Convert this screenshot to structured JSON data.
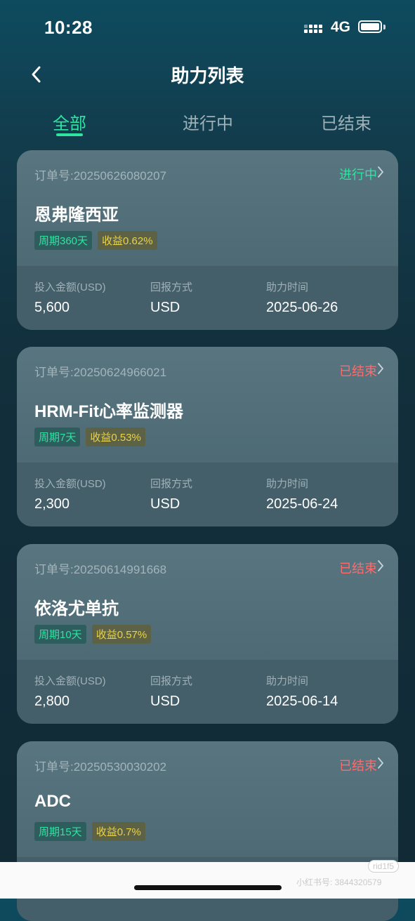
{
  "status_bar": {
    "time": "10:28",
    "network": "4G"
  },
  "header": {
    "title": "助力列表"
  },
  "tabs": [
    {
      "label": "全部",
      "active": true
    },
    {
      "label": "进行中",
      "active": false
    },
    {
      "label": "已结束",
      "active": false
    }
  ],
  "cards": [
    {
      "order_no": "订单号:20250626080207",
      "status": "进行中",
      "status_color": "#2fe3a0",
      "name": "恩弗隆西亚",
      "period": "周期360天",
      "yield": "收益0.62%",
      "amount_label": "投入金额(USD)",
      "amount": "5,600",
      "return_label": "回报方式",
      "return_value": "USD",
      "time_label": "助力时间",
      "time": "2025-06-26"
    },
    {
      "order_no": "订单号:20250624966021",
      "status": "已结束",
      "status_color": "#ff6b6b",
      "name": "HRM-Fit心率监测器",
      "period": "周期7天",
      "yield": "收益0.53%",
      "amount_label": "投入金额(USD)",
      "amount": "2,300",
      "return_label": "回报方式",
      "return_value": "USD",
      "time_label": "助力时间",
      "time": "2025-06-24"
    },
    {
      "order_no": "订单号:20250614991668",
      "status": "已结束",
      "status_color": "#ff6b6b",
      "name": "依洛尤单抗",
      "period": "周期10天",
      "yield": "收益0.57%",
      "amount_label": "投入金额(USD)",
      "amount": "2,800",
      "return_label": "回报方式",
      "return_value": "USD",
      "time_label": "助力时间",
      "time": "2025-06-14"
    },
    {
      "order_no": "订单号:20250530030202",
      "status": "已结束",
      "status_color": "#ff6b6b",
      "name": "ADC",
      "period": "周期15天",
      "yield": "收益0.7%"
    }
  ],
  "footer": {
    "watermark": "小红书号: 3844320579",
    "watermark_badge": "rid1f5"
  }
}
